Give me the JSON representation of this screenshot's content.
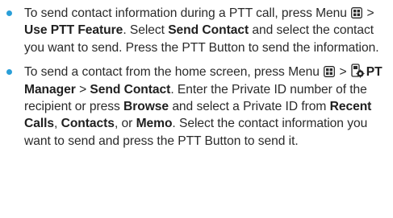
{
  "colors": {
    "bullet": "#2a9fd8",
    "text": "#2a2a2a"
  },
  "icons": {
    "menu_key": "menu-key-icon",
    "ptt_manager": "ptt-manager-icon"
  },
  "items": [
    {
      "t1": "To send contact information during a PTT call, press Menu ",
      "t2": " > ",
      "b1": "Use PTT Feature",
      "t3": ". Select ",
      "b2": "Send Contact",
      "t4": " and select the contact you want to send. Press the PTT Button to send the information."
    },
    {
      "t1": "To send a contact from the home screen, press Menu ",
      "t2": " > ",
      "b1": "PT Manager",
      "t3": " > ",
      "b2": "Send Contact",
      "t4": ". Enter the Private ID number of the recipient or press ",
      "b3": "Browse",
      "t5": " and select a Private ID from ",
      "b4": "Recent Calls",
      "t6": ", ",
      "b5": "Contacts",
      "t7": ", or ",
      "b6": "Memo",
      "t8": ". Select the contact information you want to send and press the PTT Button to send it."
    }
  ]
}
